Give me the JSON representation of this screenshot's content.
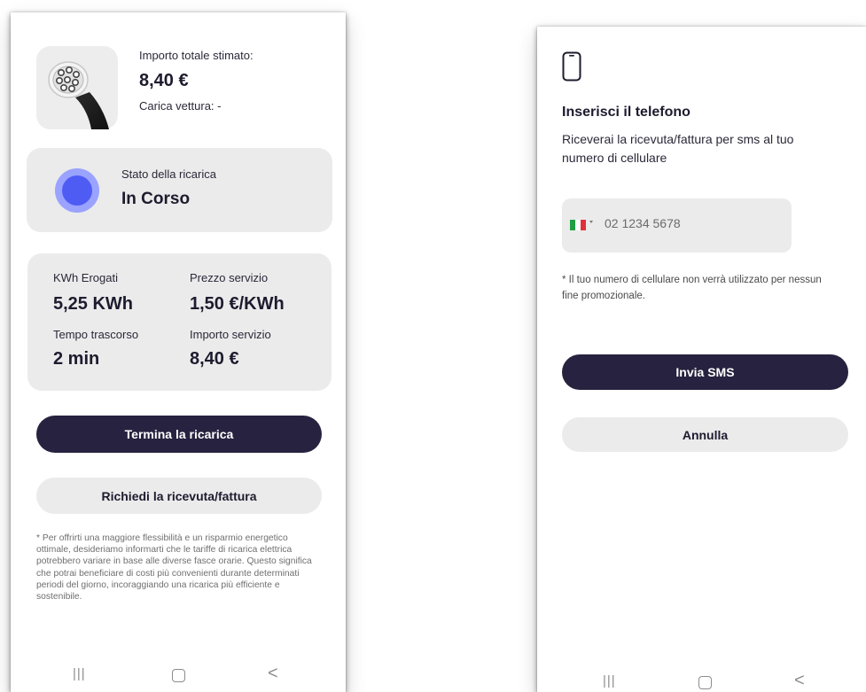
{
  "screen1": {
    "total_label": "Importo totale stimato:",
    "total_value": "8,40 €",
    "car_charge": "Carica vettura: -",
    "status_label": "Stato della ricarica",
    "status_value": "In Corso",
    "stats": {
      "kwh_label": "KWh Erogati",
      "kwh_value": "5,25 KWh",
      "price_label": "Prezzo servizio",
      "price_value": "1,50 €/KWh",
      "time_label": "Tempo trascorso",
      "time_value": "2 min",
      "amount_label": "Importo servizio",
      "amount_value": "8,40 €"
    },
    "end_button": "Termina la ricarica",
    "receipt_button": "Richiedi la ricevuta/fattura",
    "disclaimer": "* Per offrirti una maggiore flessibilità e un risparmio energetico ottimale, desideriamo informarti che le tariffe di ricarica elettrica potrebbero variare in base alle diverse fasce orarie. Questo significa che potrai beneficiare di costi più convenienti durante determinati periodi del giorno, incoraggiando una ricarica più efficiente e sostenibile."
  },
  "screen2": {
    "title": "Inserisci il telefono",
    "subtitle": "Riceverai la ricevuta/fattura per sms al tuo numero di cellulare",
    "phone_placeholder": "02 1234 5678",
    "privacy_note": "* Il tuo numero di cellulare non verrà utilizzato per nessun fine promozionale.",
    "send_button": "Invia SMS",
    "cancel_button": "Annulla"
  },
  "nav": {
    "recent": "|||",
    "back": "<"
  },
  "colors": {
    "primary_dark": "#26223f",
    "card_gray": "#ebebeb",
    "status_blue": "#4e5cf4",
    "status_blue_light": "#9aa3ff",
    "flag_green": "#229e45",
    "flag_red": "#e0313a"
  },
  "icons": [
    "ev-charger-plug-icon",
    "status-dot-icon",
    "smartphone-icon",
    "italy-flag-icon",
    "dropdown-caret-icon",
    "nav-recent-icon",
    "nav-home-icon",
    "nav-back-icon"
  ]
}
